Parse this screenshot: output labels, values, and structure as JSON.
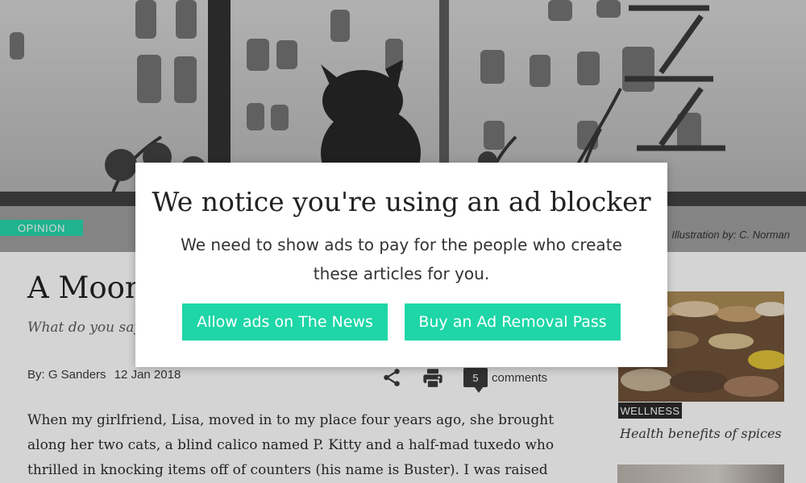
{
  "hero": {
    "category": "OPINION",
    "credit": "Illustration by: C. Norman"
  },
  "article": {
    "title_visible": "A Moon",
    "subtitle_visible": "What do you say",
    "byline": "By: G Sanders",
    "date": "12 Jan 2018",
    "comment_count": "5",
    "comments_label": "comments",
    "body": "When my girlfriend, Lisa, moved in to my place four years ago, she brought along her two cats, a blind calico named P. Kitty and a half-mad tuxedo who thrilled in knocking items off of counters (his name is Buster). I was raised"
  },
  "sidebar": {
    "category": "WELLNESS",
    "caption": "Health benefits of spices"
  },
  "dialog": {
    "title": "We notice you're using an ad blocker",
    "message": "We need to show ads to pay for the people who create these articles for you.",
    "allow_label": "Allow ads on The News",
    "buy_label": "Buy an Ad Removal Pass"
  },
  "colors": {
    "accent": "#1ed6a7",
    "dark_badge": "#222222"
  },
  "icons": {
    "share": "share-icon",
    "print": "print-icon",
    "comments": "comment-bubble-icon"
  }
}
